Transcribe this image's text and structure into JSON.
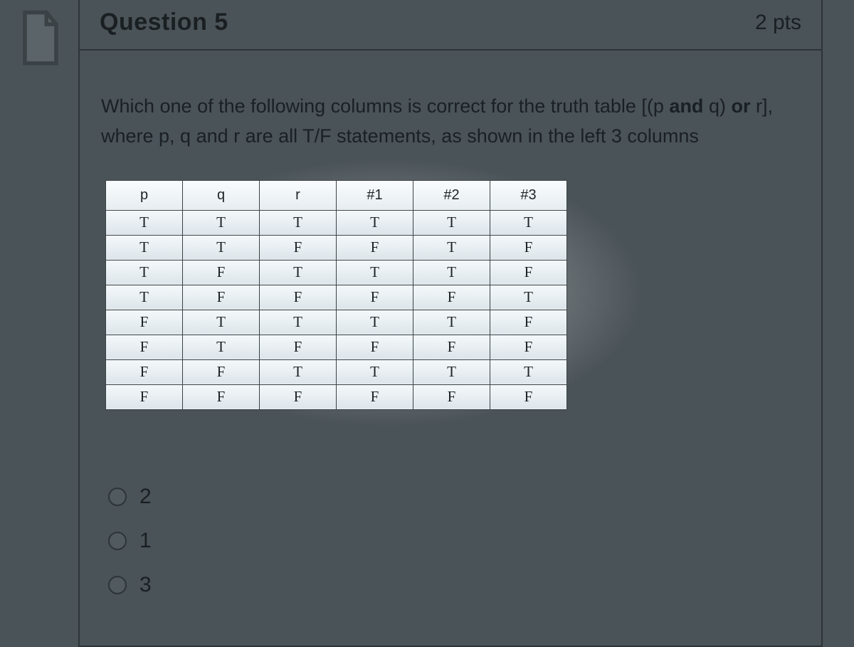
{
  "header": {
    "title": "Question 5",
    "points": "2 pts"
  },
  "prompt": {
    "line1_pre": "Which one of the following columns is correct for the truth table ",
    "lbr": "[(",
    "p": "p",
    "and": "and",
    "q": " q",
    "rpar": ")",
    "or": " or ",
    "r": "r",
    "rbr": "]",
    "line2": ", where p, q and r are all T/F statements, as shown in the left 3 columns"
  },
  "table": {
    "headers": [
      "p",
      "q",
      "r",
      "#1",
      "#2",
      "#3"
    ],
    "rows": [
      [
        "T",
        "T",
        "T",
        "T",
        "T",
        "T"
      ],
      [
        "T",
        "T",
        "F",
        "F",
        "T",
        "F"
      ],
      [
        "T",
        "F",
        "T",
        "T",
        "T",
        "F"
      ],
      [
        "T",
        "F",
        "F",
        "F",
        "F",
        "T"
      ],
      [
        "F",
        "T",
        "T",
        "T",
        "T",
        "F"
      ],
      [
        "F",
        "T",
        "F",
        "F",
        "F",
        "F"
      ],
      [
        "F",
        "F",
        "T",
        "T",
        "T",
        "T"
      ],
      [
        "F",
        "F",
        "F",
        "F",
        "F",
        "F"
      ]
    ]
  },
  "options": [
    {
      "label": "2"
    },
    {
      "label": "1"
    },
    {
      "label": "3"
    }
  ]
}
